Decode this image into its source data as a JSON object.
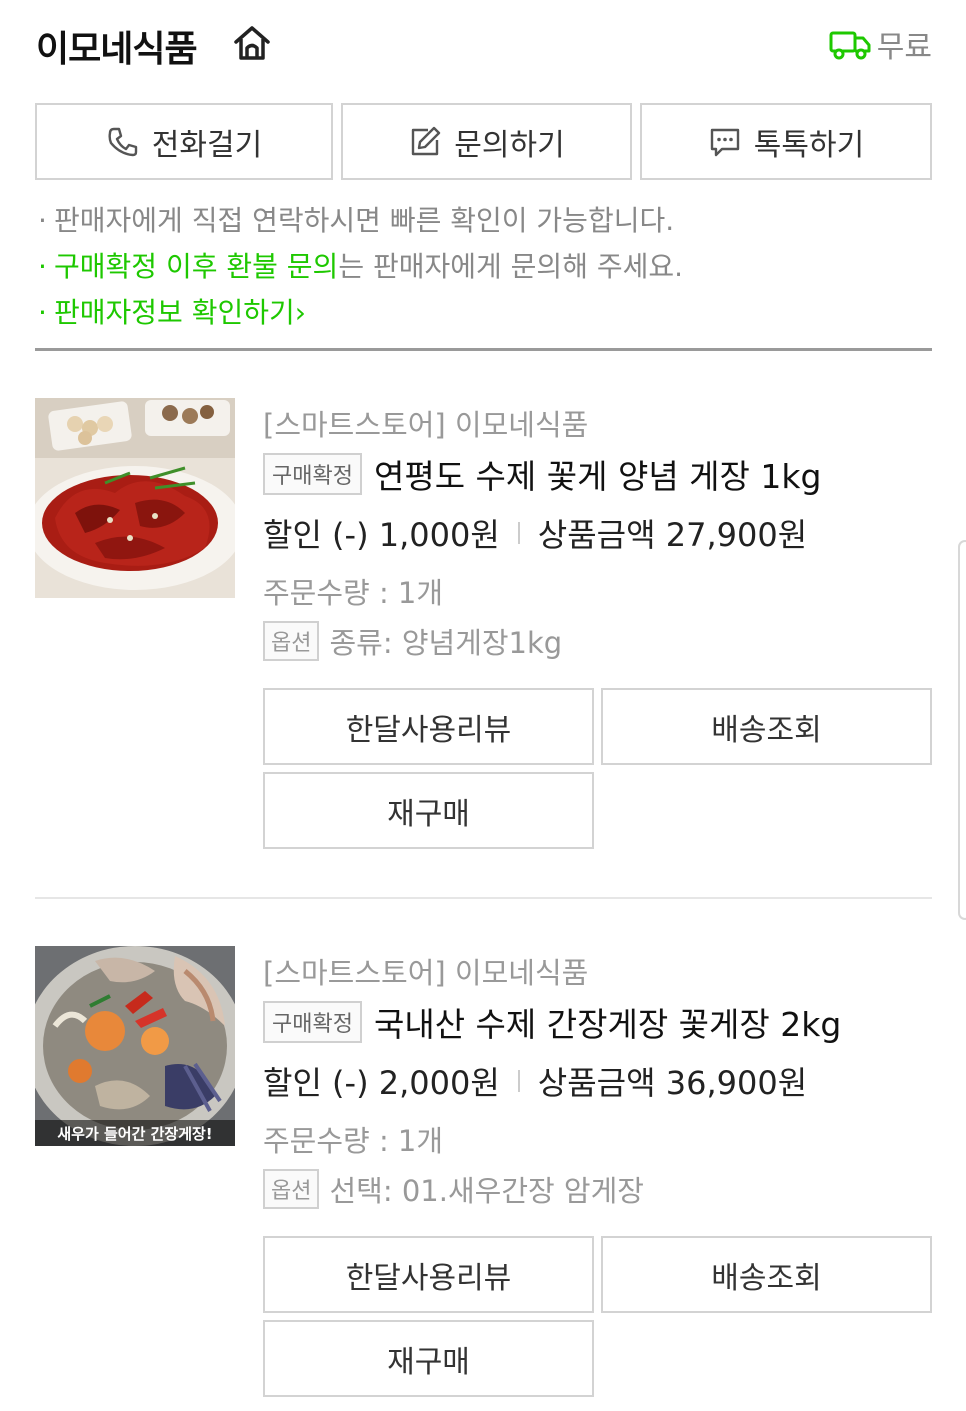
{
  "seller": {
    "name": "이모네식품",
    "shipping_label": "무료"
  },
  "contact": {
    "call_label": "전화걸기",
    "inquiry_label": "문의하기",
    "talk_label": "톡톡하기"
  },
  "notices": {
    "line1": "판매자에게 직접 연락하시면 빠른 확인이 가능합니다.",
    "line2_highlight": "구매확정 이후 환불 문의",
    "line2_rest": "는 판매자에게 문의해 주세요.",
    "line3_link": "판매자정보 확인하기",
    "line3_arrow": "›"
  },
  "orders": [
    {
      "store": "[스마트스토어] 이모네식품",
      "status": "구매확정",
      "title": "연평도 수제 꽃게 양념 게장 1kg",
      "discount": "할인 (-) 1,000원",
      "price": "상품금액 27,900원",
      "quantity": "주문수량 : 1개",
      "option_badge": "옵션",
      "option": "종류: 양념게장1kg",
      "actions": {
        "review": "한달사용리뷰",
        "shipping": "배송조회",
        "rebuy": "재구매"
      }
    },
    {
      "store": "[스마트스토어] 이모네식품",
      "status": "구매확정",
      "title": "국내산 수제 간장게장 꽃게장 2kg",
      "discount": "할인 (-) 2,000원",
      "price": "상품금액 36,900원",
      "quantity": "주문수량 : 1개",
      "option_badge": "옵션",
      "option": "선택: 01.새우간장 암게장",
      "image_caption": "새우가 들어간 간장게장!",
      "actions": {
        "review": "한달사용리뷰",
        "shipping": "배송조회",
        "rebuy": "재구매"
      }
    }
  ],
  "colors": {
    "accent": "#1ec800",
    "muted": "#888888",
    "border": "#d3d3d3"
  }
}
